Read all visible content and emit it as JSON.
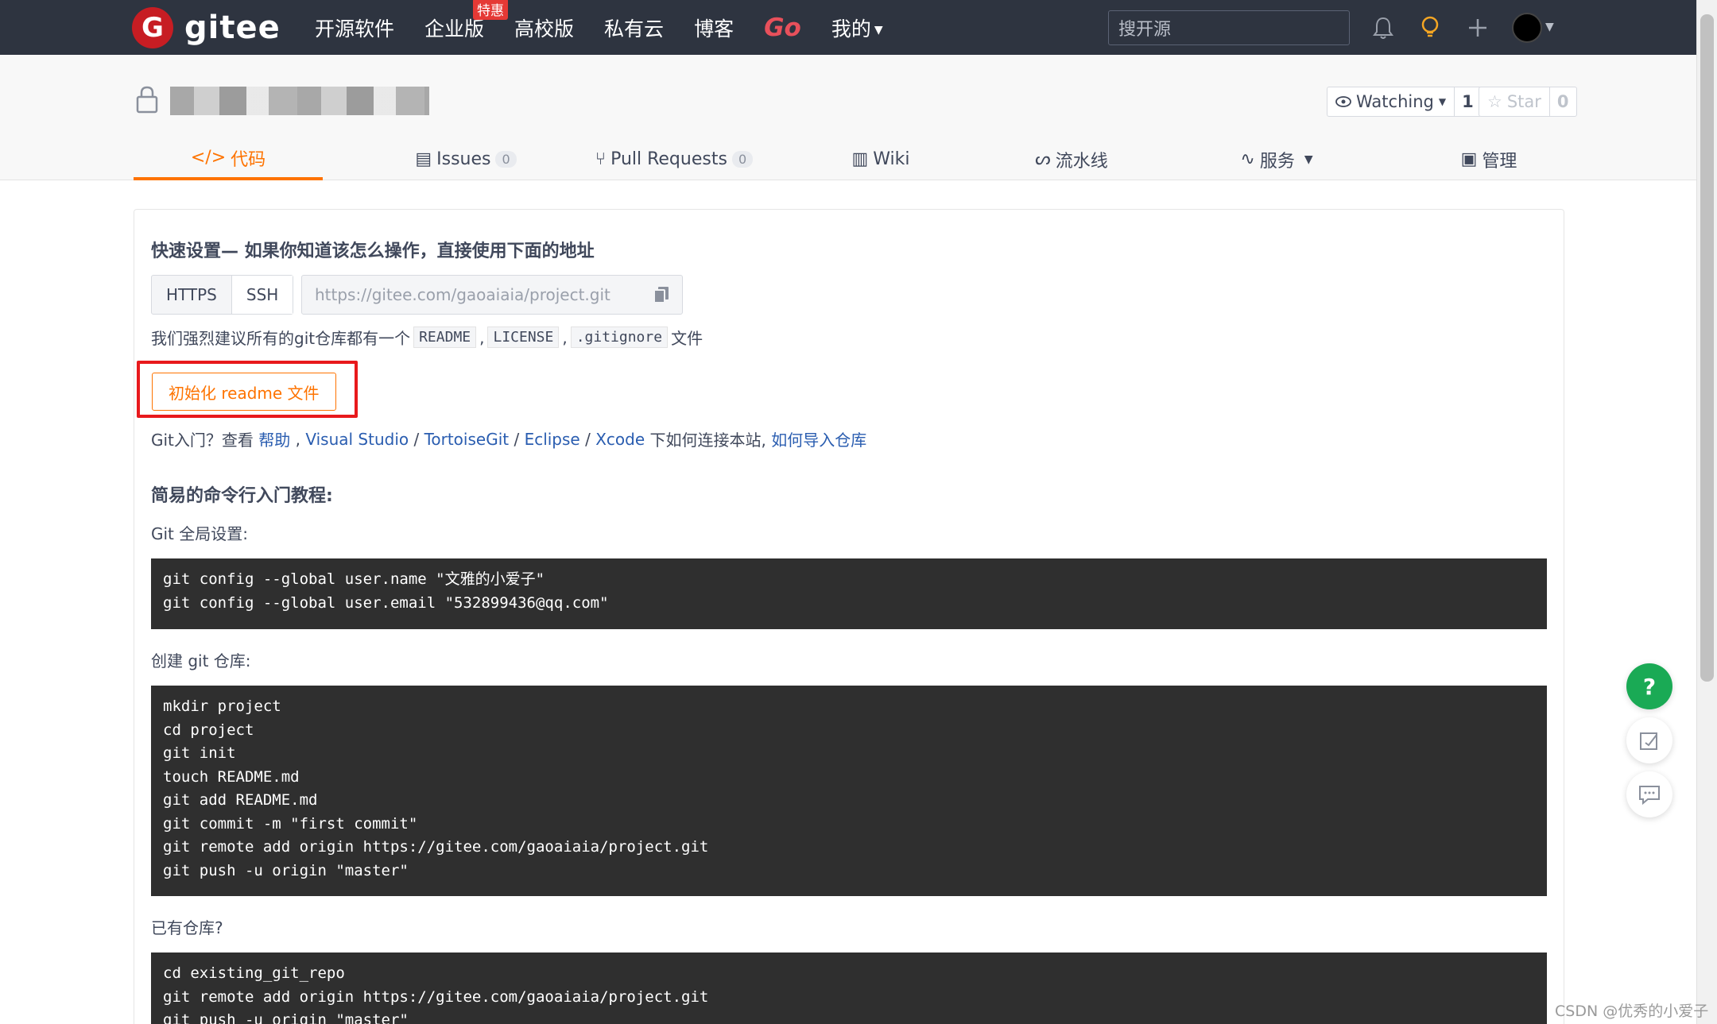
{
  "nav": {
    "brand": "gitee",
    "brand_mark": "G",
    "links": [
      "开源软件",
      "企业版",
      "高校版",
      "私有云",
      "博客",
      "Go",
      "我的"
    ],
    "hot_badge": "特惠",
    "search_placeholder": "搜开源"
  },
  "repo": {
    "watch_label": "Watching",
    "watch_count": "1",
    "star_label": "Star",
    "star_count": "0"
  },
  "tabs": {
    "code": "代码",
    "issues": "Issues",
    "issues_count": "0",
    "pulls": "Pull Requests",
    "pulls_count": "0",
    "wiki": "Wiki",
    "pipeline": "流水线",
    "services": "服务",
    "manage": "管理"
  },
  "quick": {
    "title": "快速设置— 如果你知道该怎么操作，直接使用下面的地址",
    "https": "HTTPS",
    "ssh": "SSH",
    "url": "https://gitee.com/gaoaiaia/project.git",
    "recommend_prefix": "我们强烈建议所有的git仓库都有一个",
    "readme": "README",
    "license": "LICENSE",
    "gitignore": ".gitignore",
    "comma": ",",
    "recommend_suffix": "文件",
    "init_button": "初始化 readme 文件",
    "help_prefix": "Git入门？查看",
    "help_link": "帮助",
    "vs_link": "Visual Studio",
    "tortoise_link": "TortoiseGit",
    "eclipse_link": "Eclipse",
    "xcode_link": "Xcode",
    "help_suffix": "下如何连接本站,",
    "import_link": "如何导入仓库"
  },
  "tutorial": {
    "title": "简易的命令行入门教程:",
    "global_label": "Git 全局设置:",
    "global_code": "git config --global user.name \"文雅的小爱子\"\ngit config --global user.email \"532899436@qq.com\"",
    "create_label": "创建 git 仓库:",
    "create_code": "mkdir project\ncd project\ngit init\ntouch README.md\ngit add README.md\ngit commit -m \"first commit\"\ngit remote add origin https://gitee.com/gaoaiaia/project.git\ngit push -u origin \"master\"",
    "existing_label": "已有仓库?",
    "existing_code": "cd existing_git_repo\ngit remote add origin https://gitee.com/gaoaiaia/project.git\ngit push -u origin \"master\""
  },
  "float": {
    "help": "?"
  },
  "watermark": "CSDN @优秀的小爱子",
  "colors": {
    "accent": "#fe7300",
    "nav_bg": "#2e3440",
    "brand_red": "#c71d23",
    "help_green": "#1aaa55",
    "highlight_red": "#e8191c"
  }
}
